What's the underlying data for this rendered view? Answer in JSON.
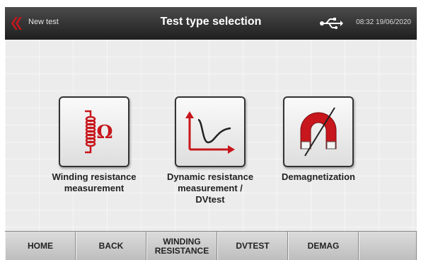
{
  "header": {
    "back_label": "New test",
    "title": "Test type selection",
    "datetime": "08:32 19/06/2020",
    "usb_icon": "usb-icon",
    "back_icon": "double-chevron-left-icon"
  },
  "tiles": [
    {
      "label": "Winding resistance\nmeasurement",
      "icon": "coil-ohm-icon"
    },
    {
      "label": "Dynamic resistance\nmeasurement /\nDVtest",
      "icon": "dynamic-curve-icon"
    },
    {
      "label": "Demagnetization",
      "icon": "crossed-magnet-icon"
    }
  ],
  "footer": {
    "buttons": [
      "HOME",
      "BACK",
      "WINDING\nRESISTANCE",
      "DVTEST",
      "DEMAG",
      ""
    ]
  },
  "colors": {
    "accent_red": "#c7161c",
    "header_bg": "#2b2b2b"
  }
}
